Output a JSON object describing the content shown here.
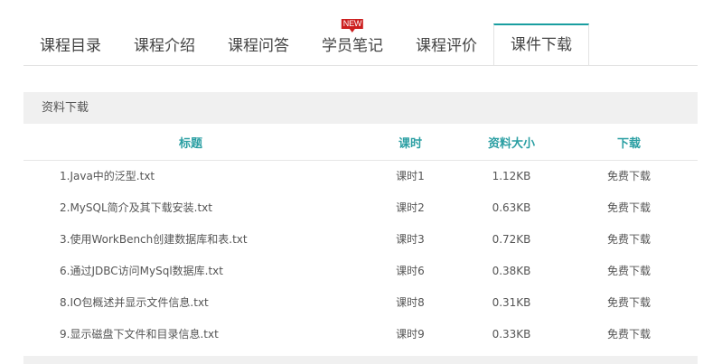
{
  "tabs": [
    {
      "label": "课程目录"
    },
    {
      "label": "课程介绍"
    },
    {
      "label": "课程问答"
    },
    {
      "label": "学员笔记",
      "badge": "NEW"
    },
    {
      "label": "课程评价"
    },
    {
      "label": "课件下载",
      "active": true
    }
  ],
  "section": {
    "title": "资料下载"
  },
  "table": {
    "headers": {
      "title": "标题",
      "lesson": "课时",
      "size": "资料大小",
      "download": "下载"
    },
    "rows": [
      {
        "title": "1.Java中的泛型.txt",
        "lesson": "课时1",
        "size": "1.12KB",
        "download": "免费下载"
      },
      {
        "title": "2.MySQL简介及其下载安装.txt",
        "lesson": "课时2",
        "size": "0.63KB",
        "download": "免费下载"
      },
      {
        "title": "3.使用WorkBench创建数据库和表.txt",
        "lesson": "课时3",
        "size": "0.72KB",
        "download": "免费下载"
      },
      {
        "title": "6.通过JDBC访问MySql数据库.txt",
        "lesson": "课时6",
        "size": "0.38KB",
        "download": "免费下载"
      },
      {
        "title": "8.IO包概述并显示文件信息.txt",
        "lesson": "课时8",
        "size": "0.31KB",
        "download": "免费下载"
      },
      {
        "title": "9.显示磁盘下文件和目录信息.txt",
        "lesson": "课时9",
        "size": "0.33KB",
        "download": "免费下载"
      }
    ]
  },
  "colors": {
    "accent": "#199ea0",
    "header_text": "#2b9fa3",
    "badge": "#cc1f1f",
    "section_bg": "#f0f0f0"
  }
}
